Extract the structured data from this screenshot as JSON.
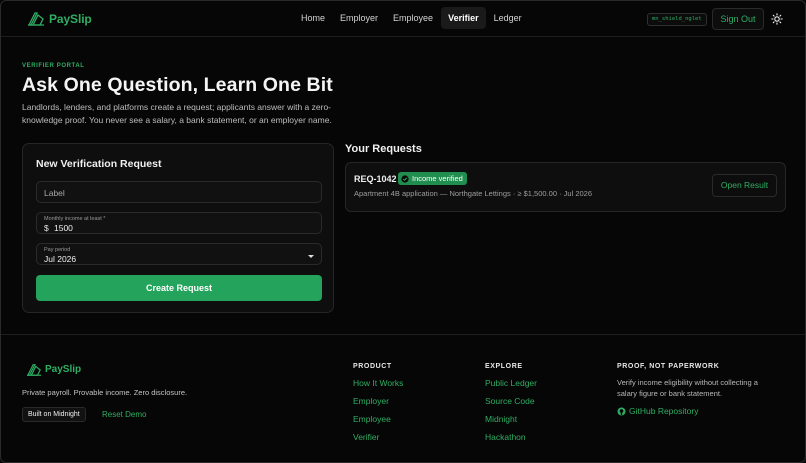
{
  "header": {
    "brand": "PaySlip",
    "nav": [
      {
        "label": "Home",
        "active": false
      },
      {
        "label": "Employer",
        "active": false
      },
      {
        "label": "Employee",
        "active": false
      },
      {
        "label": "Verifier",
        "active": true
      },
      {
        "label": "Ledger",
        "active": false
      }
    ],
    "network_chip": "mn_shield_nglet",
    "signout_label": "Sign Out",
    "theme_icon": "sun-icon"
  },
  "hero": {
    "eyebrow": "VERIFIER PORTAL",
    "title": "Ask One Question, Learn One Bit",
    "subtitle": "Landlords, lenders, and platforms create a request; applicants answer with a zero-knowledge proof. You never see a salary, a bank statement, or an employer name."
  },
  "new_request": {
    "title": "New Verification Request",
    "label_placeholder": "Label",
    "income_label": "Monthly income at least *",
    "currency": "$",
    "income_value": "1500",
    "period_label": "Pay period",
    "period_value": "Jul 2026",
    "create_label": "Create Request"
  },
  "requests": {
    "title": "Your Requests",
    "items": [
      {
        "id": "REQ-1042",
        "status": "Income verified",
        "description": "Apartment 4B application — Northgate Lettings · ≥ $1,500.00 · Jul 2026",
        "action": "Open Result"
      }
    ]
  },
  "footer": {
    "brand": "PaySlip",
    "tagline": "Private payroll. Provable income. Zero disclosure.",
    "built_on": "Built on Midnight",
    "reset_label": "Reset Demo",
    "product": {
      "heading": "PRODUCT",
      "links": [
        "How It Works",
        "Employer",
        "Employee",
        "Verifier"
      ]
    },
    "explore": {
      "heading": "EXPLORE",
      "links": [
        "Public Ledger",
        "Source Code",
        "Midnight",
        "Hackathon"
      ]
    },
    "proof": {
      "heading": "PROOF, NOT PAPERWORK",
      "text": "Verify income eligibility without collecting a salary figure or bank statement.",
      "github": "GitHub Repository"
    }
  },
  "colors": {
    "accent": "#2fae63",
    "button": "#23a35b",
    "background": "#060606",
    "card": "#0e0e0e"
  }
}
